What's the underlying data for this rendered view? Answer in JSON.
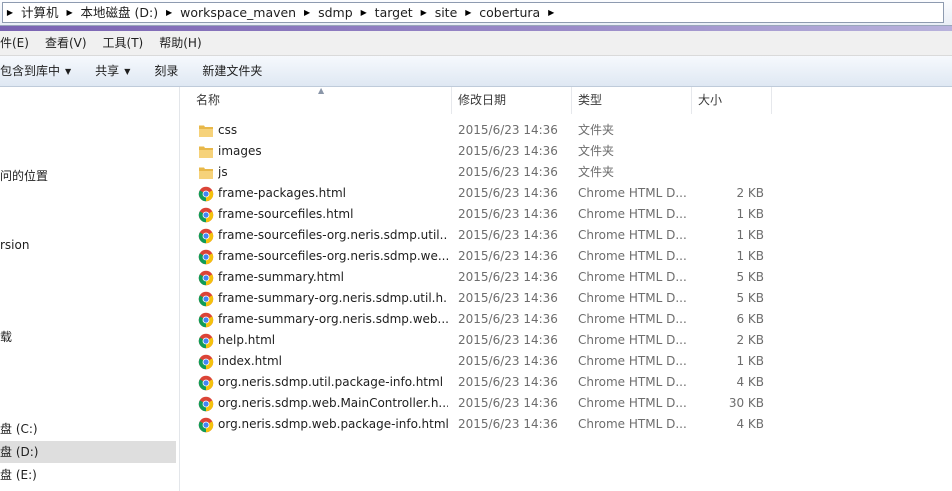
{
  "address_bar": {
    "crumbs": [
      "计算机",
      "本地磁盘 (D:)",
      "workspace_maven",
      "sdmp",
      "target",
      "site",
      "cobertura"
    ]
  },
  "menu": {
    "items": [
      "件(E)",
      "查看(V)",
      "工具(T)",
      "帮助(H)"
    ]
  },
  "command_bar": {
    "include_library": "包含到库中",
    "share": "共享",
    "burn": "刻录",
    "new_folder": "新建文件夹"
  },
  "nav": {
    "items": [
      "问的位置",
      "rsion",
      "载",
      "盘 (C:)",
      "盘 (D:)",
      "盘 (E:)"
    ]
  },
  "columns": {
    "name": "名称",
    "date": "修改日期",
    "type": "类型",
    "size": "大小"
  },
  "files": [
    {
      "name": "css",
      "date": "2015/6/23 14:36",
      "type": "文件夹",
      "size": "",
      "icon": "folder-icon"
    },
    {
      "name": "images",
      "date": "2015/6/23 14:36",
      "type": "文件夹",
      "size": "",
      "icon": "folder-icon"
    },
    {
      "name": "js",
      "date": "2015/6/23 14:36",
      "type": "文件夹",
      "size": "",
      "icon": "folder-icon"
    },
    {
      "name": "frame-packages.html",
      "date": "2015/6/23 14:36",
      "type": "Chrome HTML D...",
      "size": "2 KB",
      "icon": "chrome-icon"
    },
    {
      "name": "frame-sourcefiles.html",
      "date": "2015/6/23 14:36",
      "type": "Chrome HTML D...",
      "size": "1 KB",
      "icon": "chrome-icon"
    },
    {
      "name": "frame-sourcefiles-org.neris.sdmp.util....",
      "date": "2015/6/23 14:36",
      "type": "Chrome HTML D...",
      "size": "1 KB",
      "icon": "chrome-icon"
    },
    {
      "name": "frame-sourcefiles-org.neris.sdmp.we...",
      "date": "2015/6/23 14:36",
      "type": "Chrome HTML D...",
      "size": "1 KB",
      "icon": "chrome-icon"
    },
    {
      "name": "frame-summary.html",
      "date": "2015/6/23 14:36",
      "type": "Chrome HTML D...",
      "size": "5 KB",
      "icon": "chrome-icon"
    },
    {
      "name": "frame-summary-org.neris.sdmp.util.h...",
      "date": "2015/6/23 14:36",
      "type": "Chrome HTML D...",
      "size": "5 KB",
      "icon": "chrome-icon"
    },
    {
      "name": "frame-summary-org.neris.sdmp.web....",
      "date": "2015/6/23 14:36",
      "type": "Chrome HTML D...",
      "size": "6 KB",
      "icon": "chrome-icon"
    },
    {
      "name": "help.html",
      "date": "2015/6/23 14:36",
      "type": "Chrome HTML D...",
      "size": "2 KB",
      "icon": "chrome-icon"
    },
    {
      "name": "index.html",
      "date": "2015/6/23 14:36",
      "type": "Chrome HTML D...",
      "size": "1 KB",
      "icon": "chrome-icon"
    },
    {
      "name": "org.neris.sdmp.util.package-info.html",
      "date": "2015/6/23 14:36",
      "type": "Chrome HTML D...",
      "size": "4 KB",
      "icon": "chrome-icon"
    },
    {
      "name": "org.neris.sdmp.web.MainController.h...",
      "date": "2015/6/23 14:36",
      "type": "Chrome HTML D...",
      "size": "30 KB",
      "icon": "chrome-icon"
    },
    {
      "name": "org.neris.sdmp.web.package-info.html",
      "date": "2015/6/23 14:36",
      "type": "Chrome HTML D...",
      "size": "4 KB",
      "icon": "chrome-icon"
    }
  ],
  "colors": {
    "folder": "#e8b84a",
    "chrome_red": "#db4437",
    "chrome_yellow": "#f4c20d",
    "chrome_green": "#0f9d58",
    "chrome_blue": "#4285f4",
    "selection": "#dedede"
  }
}
